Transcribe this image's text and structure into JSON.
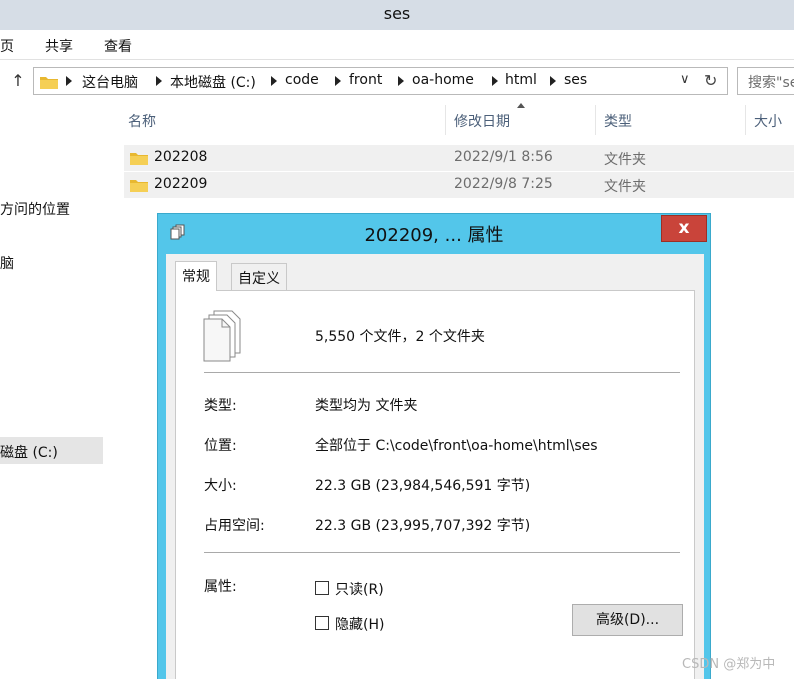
{
  "window": {
    "title": "ses"
  },
  "ribbon": {
    "tabs": [
      "页",
      "共享",
      "查看"
    ]
  },
  "address": {
    "crumbs": [
      "这台电脑",
      "本地磁盘 (C:)",
      "code",
      "front",
      "oa-home",
      "html",
      "ses"
    ],
    "search_placeholder": "搜索\"se"
  },
  "nav": {
    "items": [
      {
        "label": "方问的位置"
      },
      {
        "label": "脑"
      },
      {
        "label": "磁盘 (C:)",
        "selected": true
      }
    ]
  },
  "filelist": {
    "columns": [
      "名称",
      "修改日期",
      "类型",
      "大小"
    ],
    "rows": [
      {
        "name": "202208",
        "date": "2022/9/1 8:56",
        "type": "文件夹"
      },
      {
        "name": "202209",
        "date": "2022/9/8 7:25",
        "type": "文件夹"
      }
    ]
  },
  "dialog": {
    "title": "202209, ... 属性",
    "close": "x",
    "tabs": [
      "常规",
      "自定义"
    ],
    "summary": "5,550 个文件，2 个文件夹",
    "type_label": "类型:",
    "type_value": "类型均为 文件夹",
    "location_label": "位置:",
    "location_value": "全部位于 C:\\code\\front\\oa-home\\html\\ses",
    "size_label": "大小:",
    "size_value": "22.3 GB (23,984,546,591 字节)",
    "disk_label": "占用空间:",
    "disk_value": "22.3 GB (23,995,707,392 字节)",
    "attr_label": "属性:",
    "readonly_label": "只读(R)",
    "hidden_label": "隐藏(H)",
    "advanced_button": "高级(D)..."
  },
  "watermark": "CSDN @郑为中",
  "colors": {
    "dialog_frame": "#53c6ea",
    "close_button": "#c9443a",
    "folder": "#e8b830"
  }
}
